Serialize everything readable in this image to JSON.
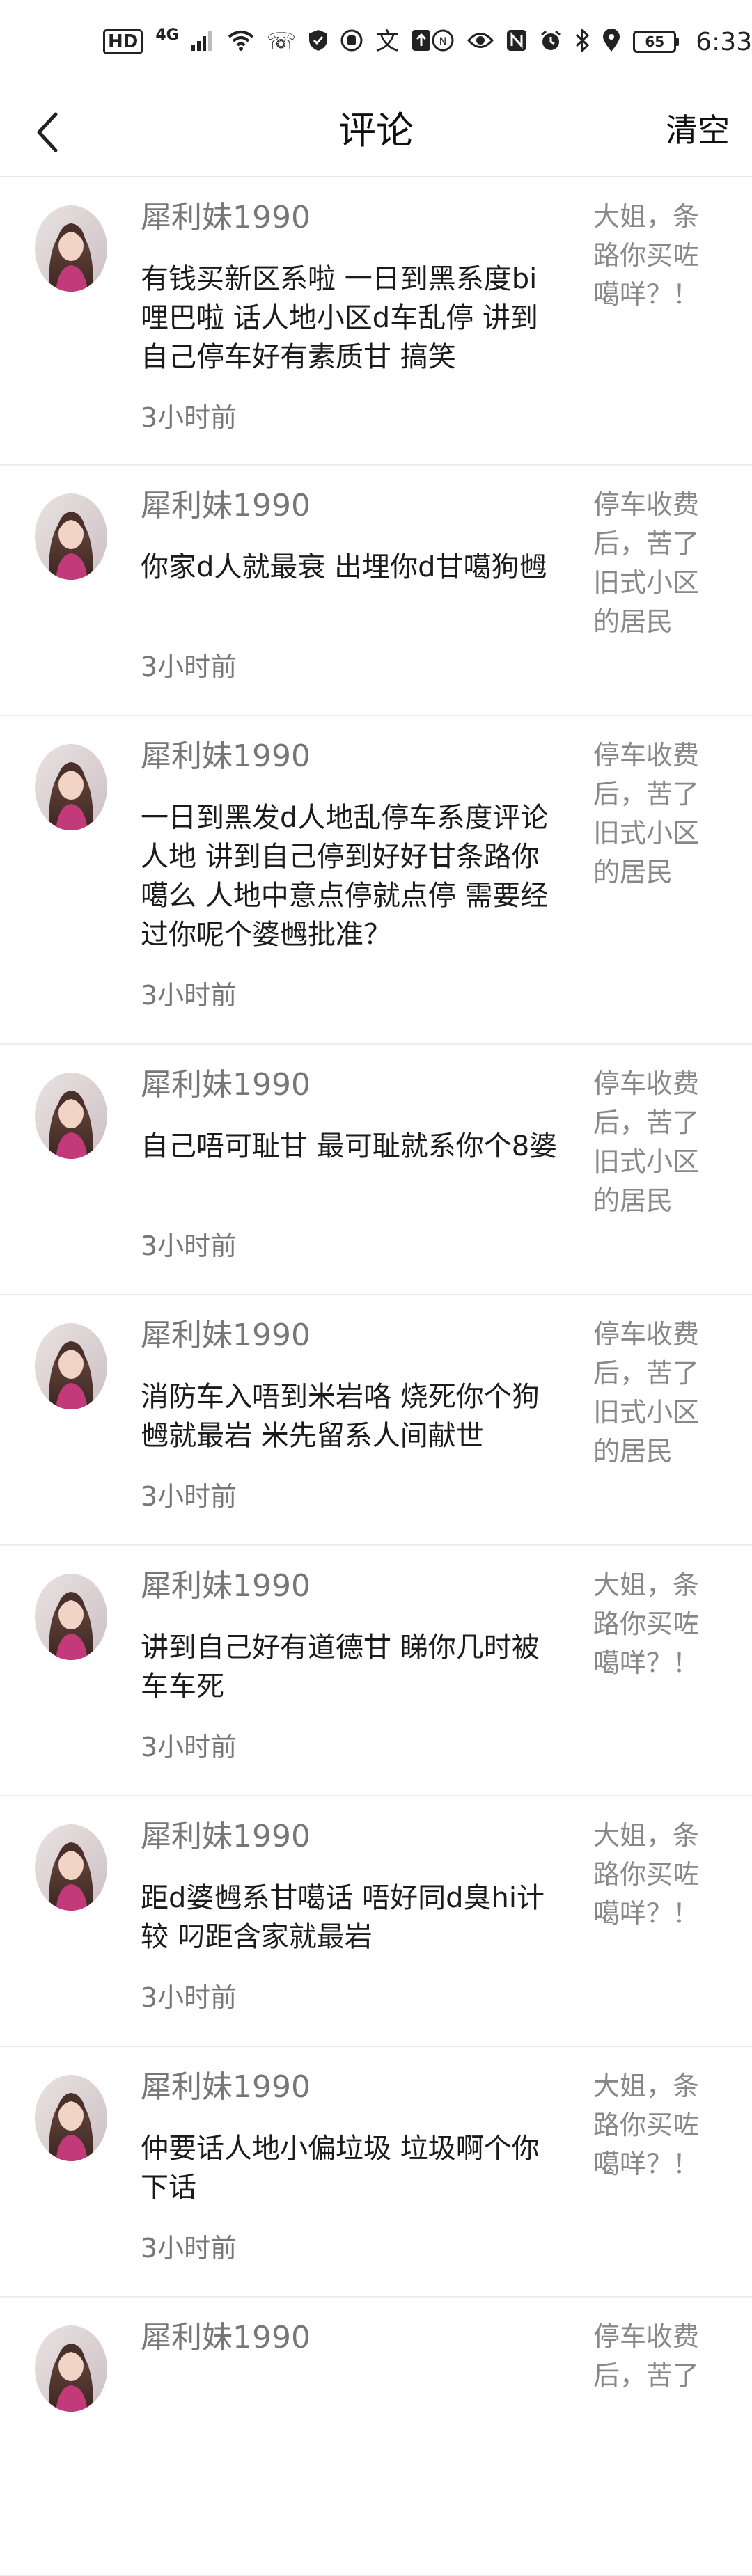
{
  "status_bar": {
    "hd": "HD",
    "network": "4G",
    "battery": "65",
    "time": "6:33",
    "left_icons": [
      "signal-icon",
      "wifi-icon",
      "missed-call-icon",
      "shield-icon",
      "app-icon",
      "translate-icon",
      "upload-icon"
    ],
    "right_icons": [
      "nfc-icon",
      "eye-icon",
      "nfc-tag-icon",
      "alarm-icon",
      "bluetooth-icon",
      "location-icon"
    ]
  },
  "header": {
    "back_icon": "chevron-left-icon",
    "title": "评论",
    "clear_label": "清空"
  },
  "comments": [
    {
      "username": "犀利妹1990",
      "text": "有钱买新区系啦 一日到黑系度bi哩巴啦 话人地小区d车乱停 讲到自己停车好有素质甘 搞笑",
      "time": "3小时前",
      "post_excerpt": "大姐，条路你买咗噶咩？！"
    },
    {
      "username": "犀利妹1990",
      "text": "你家d人就最衰 出埋你d甘噶狗乸",
      "time": "3小时前",
      "post_excerpt": "停车收费后，苦了旧式小区的居民"
    },
    {
      "username": "犀利妹1990",
      "text": "一日到黑发d人地乱停车系度评论人地 讲到自己停到好好甘条路你噶么 人地中意点停就点停 需要经过你呢个婆乸批准？",
      "time": "3小时前",
      "post_excerpt": "停车收费后，苦了旧式小区的居民"
    },
    {
      "username": "犀利妹1990",
      "text": "自己唔可耻甘 最可耻就系你个8婆",
      "time": "3小时前",
      "post_excerpt": "停车收费后，苦了旧式小区的居民"
    },
    {
      "username": "犀利妹1990",
      "text": "消防车入唔到米岩咯 烧死你个狗乸就最岩 米先留系人间献世",
      "time": "3小时前",
      "post_excerpt": "停车收费后，苦了旧式小区的居民"
    },
    {
      "username": "犀利妹1990",
      "text": "讲到自己好有道德甘 睇你几时被车车死",
      "time": "3小时前",
      "post_excerpt": "大姐，条路你买咗噶咩？！"
    },
    {
      "username": "犀利妹1990",
      "text": "距d婆乸系甘噶话 唔好同d臭hi计较 叼距含家就最岩",
      "time": "3小时前",
      "post_excerpt": "大姐，条路你买咗噶咩？！"
    },
    {
      "username": "犀利妹1990",
      "text": "仲要话人地小偏垃圾 垃圾啊个你下话",
      "time": "3小时前",
      "post_excerpt": "大姐，条路你买咗噶咩？！"
    },
    {
      "username": "犀利妹1990",
      "text": "",
      "time": "",
      "post_excerpt": "停车收费后，苦了"
    }
  ]
}
